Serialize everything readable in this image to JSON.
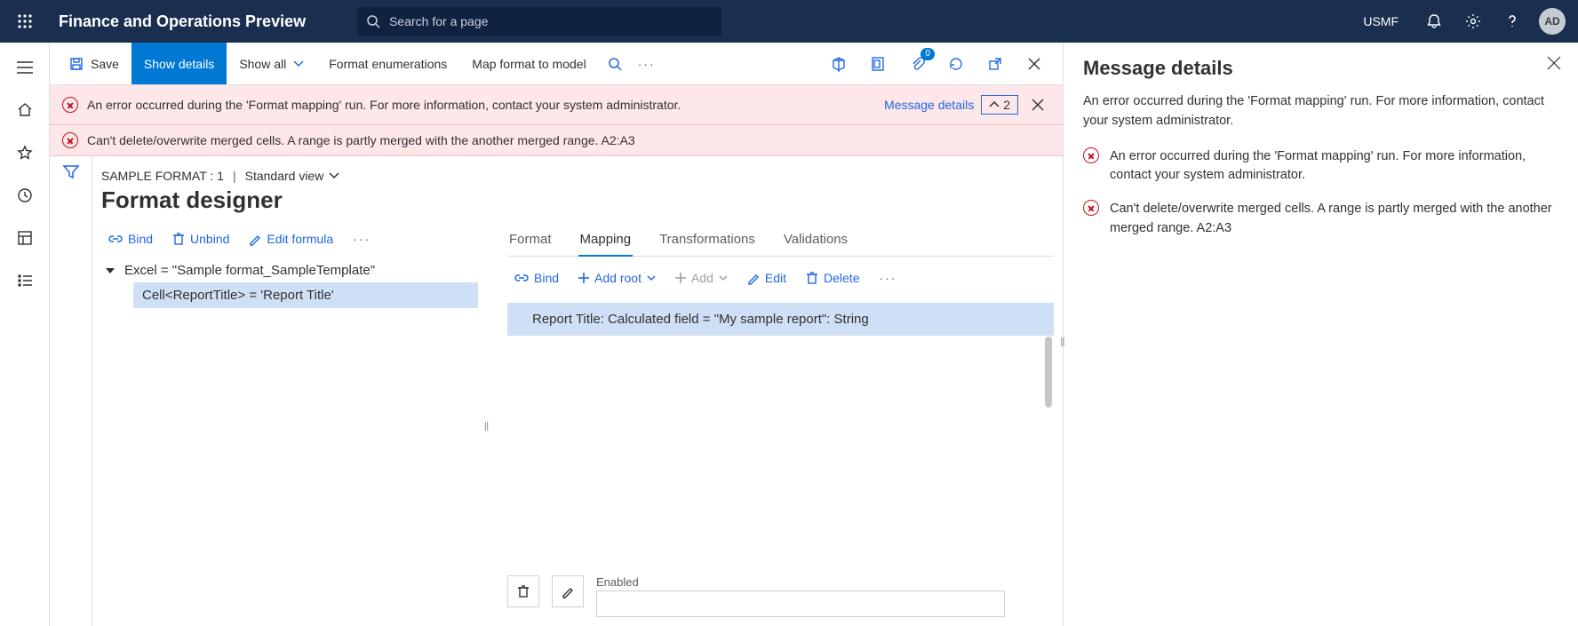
{
  "top": {
    "title": "Finance and Operations Preview",
    "search_placeholder": "Search for a page",
    "entity": "USMF",
    "avatar": "AD"
  },
  "actionbar": {
    "save": "Save",
    "show_details": "Show details",
    "show_all": "Show all",
    "format_enum": "Format enumerations",
    "map_format": "Map format to model",
    "clip_badge": "0"
  },
  "banner": {
    "error1": "An error occurred during the 'Format mapping' run. For more information, contact your system administrator.",
    "error2": "Can't delete/overwrite merged cells. A range is partly merged with the another merged range. A2:A3",
    "link": "Message details",
    "count": "2"
  },
  "page": {
    "crumb_left": "SAMPLE FORMAT : 1",
    "crumb_view": "Standard view",
    "title": "Format designer"
  },
  "left_tools": {
    "bind": "Bind",
    "unbind": "Unbind",
    "edit_formula": "Edit formula"
  },
  "tree": {
    "root": "Excel = \"Sample format_SampleTemplate\"",
    "child": "Cell<ReportTitle> = 'Report Title'"
  },
  "tabs": {
    "format": "Format",
    "mapping": "Mapping",
    "transformations": "Transformations",
    "validations": "Validations"
  },
  "right_tools": {
    "bind": "Bind",
    "add_root": "Add root",
    "add": "Add",
    "edit": "Edit",
    "delete": "Delete"
  },
  "mapping_row": "Report Title: Calculated field = \"My sample report\": String",
  "prop": {
    "enabled": "Enabled"
  },
  "panel": {
    "title": "Message details",
    "summary": "An error occurred during the 'Format mapping' run. For more information, contact your system administrator.",
    "msgs": [
      "An error occurred during the 'Format mapping' run. For more information, contact your system administrator.",
      "Can't delete/overwrite merged cells. A range is partly merged with the another merged range. A2:A3"
    ]
  }
}
